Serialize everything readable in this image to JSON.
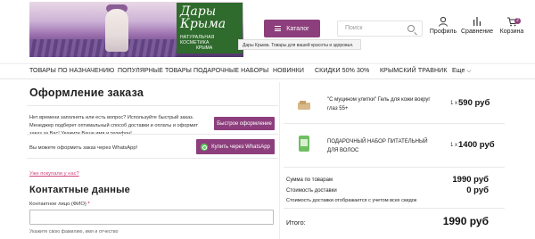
{
  "header": {
    "brand_line1": "Дары",
    "brand_line2": "Крыма",
    "brand_tagline": "НАТУРАЛЬНАЯ КОСМЕТИКА",
    "brand_tagline2": "КРЫМА",
    "catalog_label": "Каталог",
    "search_placeholder": "Поиск",
    "tooltip": "Дары Крыма. Товары для вашей красоты и здоровья.",
    "profile_label": "Профиль",
    "compare_label": "Сравнение",
    "cart_label": "Корзина",
    "cart_count": "2"
  },
  "nav": {
    "items": [
      "ТОВАРЫ ПО НАЗНАЧЕНИЮ",
      "ПОПУЛЯРНЫЕ ТОВАРЫ",
      "ПОДАРОЧНЫЕ НАБОРЫ",
      "НОВИНКИ",
      "СКИДКИ 50% 30%",
      "КРЫМСКИЙ ТРАВНИК",
      "Еще"
    ]
  },
  "checkout": {
    "title": "Оформление заказа",
    "quick_text": "Нет времени заполнять или есть вопрос? Используйте быстрый заказ. Менеджер подберет оптимальный способ доставки и оплаты и оформит заказ за Вас! Укажите Ваше имя и телефон!",
    "quick_button": "Быстрое оформление",
    "whatsapp_text": "Вы можете оформить заказ через WhatsApp!",
    "whatsapp_button": "Купить через WhatsApp",
    "already_bought": "Уже покупали у нас?",
    "contact_title": "Контактные данные",
    "fio_label": "Контактное лицо (ФИО)",
    "fio_required": "*",
    "fio_value": "",
    "hint": "Укажите свою фамилию, имя и отчество"
  },
  "cart": {
    "items": [
      {
        "name": "\"С муцином улитки\" Гель для кожи вокруг глаз 55+",
        "qty": "1 x",
        "price": "590 руб"
      },
      {
        "name": "ПОДАРОЧНЫЙ НАБОР ПИТАТЕЛЬНЫЙ ДЛЯ ВОЛОС",
        "qty": "1 x",
        "price": "1400 руб"
      }
    ],
    "sum_label": "Сумма по товарам",
    "sum_value": "1990 руб",
    "delivery_label": "Стоимость доставки",
    "delivery_value": "0 руб",
    "delivery_note": "Стоимость доставки отображается с учетом всех скидок",
    "total_label": "Итого:",
    "total_value": "1990 руб"
  },
  "colors": {
    "accent": "#8d3f7d",
    "brand_green": "#2f6b2c",
    "link_pink": "#d0457d",
    "whatsapp_green": "#5ac95a"
  }
}
